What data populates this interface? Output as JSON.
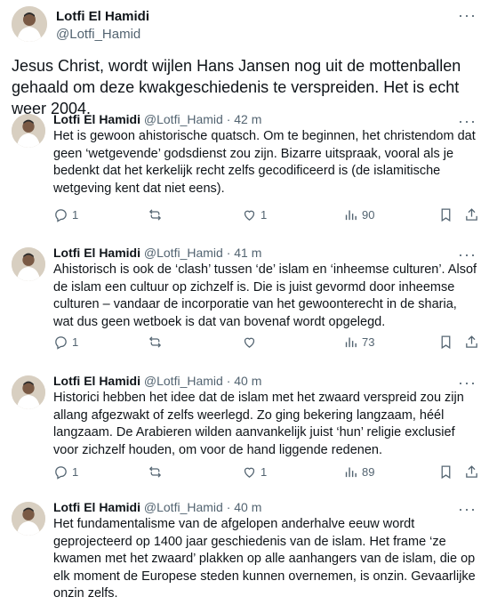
{
  "main_tweet": {
    "author": "Lotfi El Hamidi",
    "handle": "@Lotfi_Hamid",
    "text": "Jesus Christ, wordt wijlen Hans Jansen nog uit de mottenballen gehaald om deze kwakgeschiedenis te verspreiden. Het is echt weer 2004."
  },
  "replies": [
    {
      "author": "Lotfi El Hamidi",
      "handle": "@Lotfi_Hamid",
      "time": "42 m",
      "text": "Het is gewoon ahistorische quatsch. Om te beginnen, het christendom dat geen ‘wetgevende’ godsdienst zou zijn. Bizarre uitspraak, vooral als je bedenkt dat het kerkelijk recht zelfs gecodificeerd is (de islamitische wetgeving kent dat niet eens).",
      "replies_count": "1",
      "retweets_count": "",
      "likes_count": "1",
      "views_count": "90"
    },
    {
      "author": "Lotfi El Hamidi",
      "handle": "@Lotfi_Hamid",
      "time": "41 m",
      "text": "Ahistorisch is ook de ‘clash’ tussen ‘de’ islam en ‘inheemse culturen’. Alsof de islam een cultuur op zichzelf is. Die is juist gevormd door inheemse culturen – vandaar de incorporatie van het gewoonterecht in de sharia, wat dus geen wetboek is dat van bovenaf wordt opgelegd.",
      "replies_count": "1",
      "retweets_count": "",
      "likes_count": "",
      "views_count": "73"
    },
    {
      "author": "Lotfi El Hamidi",
      "handle": "@Lotfi_Hamid",
      "time": "40 m",
      "text": "Historici hebben het idee dat de islam met het zwaard verspreid zou zijn allang afgezwakt of zelfs weerlegd. Zo ging bekering langzaam, héél langzaam. De Arabieren wilden aanvankelijk juist ‘hun’ religie exclusief voor zichzelf houden, om voor de hand liggende redenen.",
      "replies_count": "1",
      "retweets_count": "",
      "likes_count": "1",
      "views_count": "89"
    },
    {
      "author": "Lotfi El Hamidi",
      "handle": "@Lotfi_Hamid",
      "time": "40 m",
      "text": "Het fundamentalisme van de afgelopen anderhalve eeuw wordt geprojecteerd op 1400 jaar geschiedenis van de islam. Het frame ‘ze kwamen met het zwaard’ plakken op alle aanhangers van de islam, die op elk moment de Europese steden kunnen overnemen, is onzin. Gevaarlijke onzin zelfs."
    }
  ],
  "icons": {
    "more": "more-dots-icon",
    "reply": "reply-bubble-icon",
    "retweet": "retweet-icon",
    "like": "heart-icon",
    "views": "views-chart-icon",
    "bookmark": "bookmark-icon",
    "share": "share-icon"
  }
}
